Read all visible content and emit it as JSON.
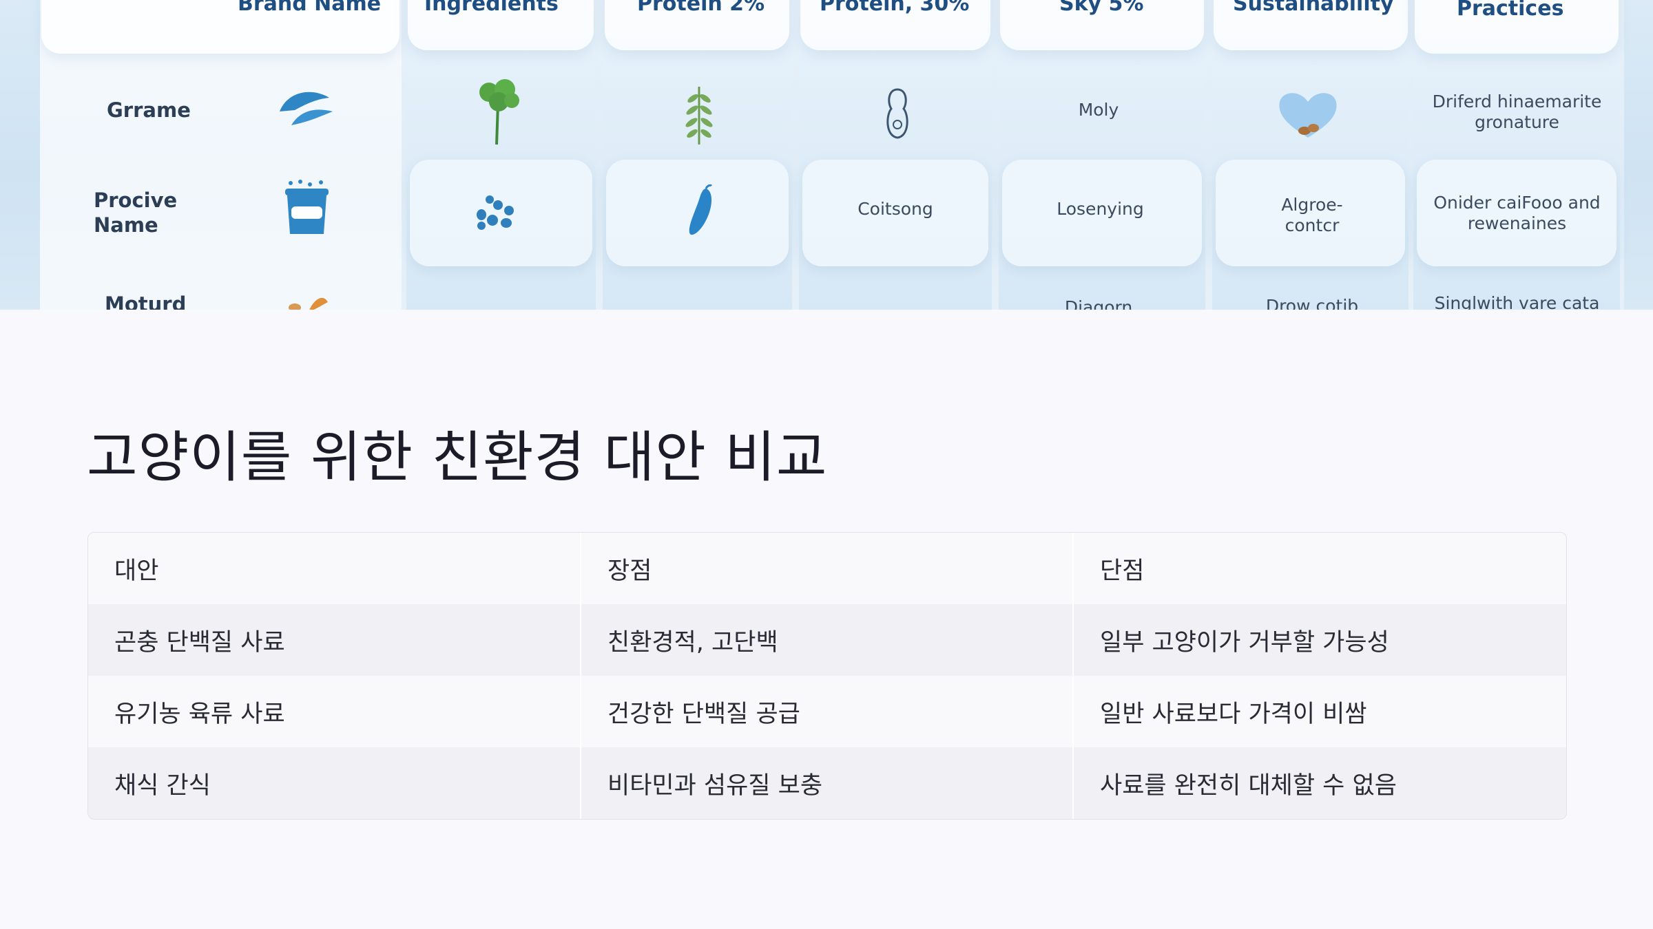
{
  "hero": {
    "headers": [
      "Brand Name",
      "Ingredients",
      "Protein 2%",
      "Protein, 30%",
      "Sky 5%",
      "Sustainability",
      "Practices"
    ],
    "row_labels": [
      "Grrame",
      "Procive Name",
      "Moturd"
    ],
    "cells": {
      "r1_sky": "Moly",
      "r1_practices": "Driferd hinaemarite gronature",
      "r2_protein30": "Coitsong",
      "r2_sky": "Losenying",
      "r2_sustain": "Algroe- contcr",
      "r2_practices": "Onider caiFooo and rewenaines",
      "r3_sky": "Diagorn",
      "r3_sustain": "Drow cotib",
      "r3_practices": "Singlwith vare cata"
    },
    "icons": [
      "fish-icon",
      "plant-icon",
      "leaf-sprig-icon",
      "peanut-icon",
      "heart-seeds-icon",
      "water-bucket-icon",
      "paw-print-icon",
      "chili-icon",
      "food-icon"
    ]
  },
  "page": {
    "title": "고양이를 위한 친환경 대안 비교"
  },
  "table": {
    "headers": [
      "대안",
      "장점",
      "단점"
    ],
    "rows": [
      [
        "곤충 단백질 사료",
        "친환경적, 고단백",
        "일부 고양이가 거부할 가능성"
      ],
      [
        "유기농 육류 사료",
        "건강한 단백질 공급",
        "일반 사료보다 가격이 비쌈"
      ],
      [
        "채식 간식",
        "비타민과 섬유질 보충",
        "사료를 완전히 대체할 수 없음"
      ]
    ]
  }
}
